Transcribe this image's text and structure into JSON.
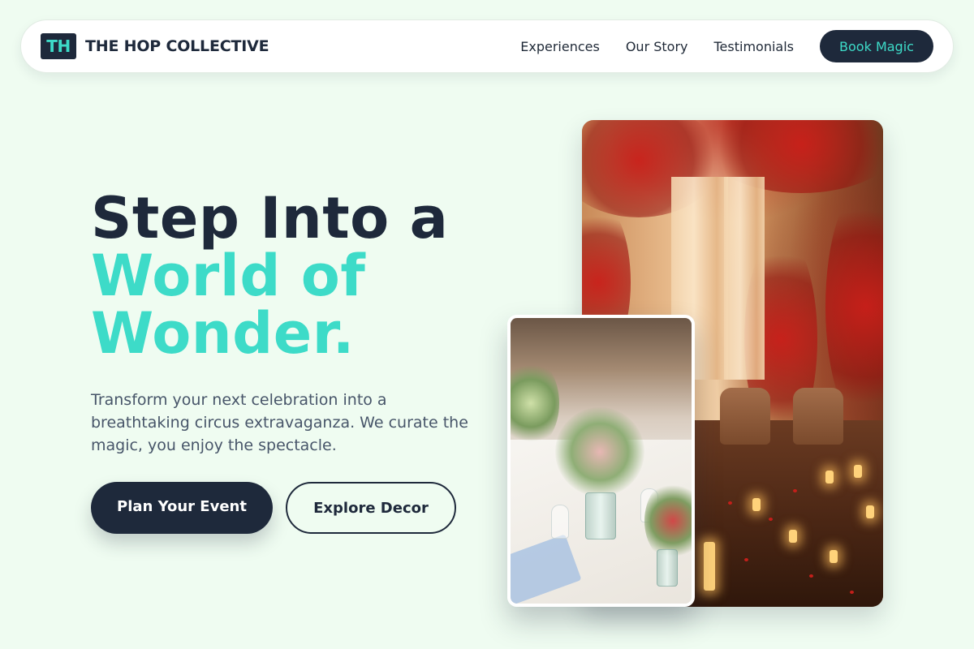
{
  "brand": {
    "logo_text": "TH",
    "name": "THE HOP COLLECTIVE"
  },
  "nav": {
    "links": [
      "Experiences",
      "Our Story",
      "Testimonials"
    ],
    "cta": "Book Magic"
  },
  "hero": {
    "title_line1": "Step Into a",
    "title_line2": "World of",
    "title_line3": "Wonder.",
    "subtitle": "Transform your next celebration into a breathtaking circus extravaganza. We curate the magic, you enjoy the spectacle.",
    "primary_button": "Plan Your Event",
    "secondary_button": "Explore Decor"
  },
  "colors": {
    "background": "#effcf1",
    "primary": "#1e293b",
    "accent": "#3ddbc8"
  }
}
